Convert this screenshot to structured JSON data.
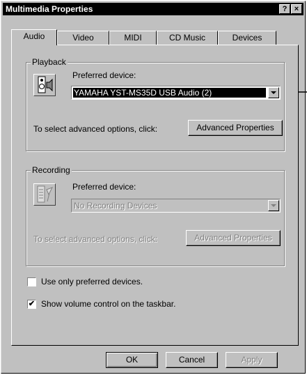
{
  "window": {
    "title": "Multimedia Properties",
    "help_button": "?",
    "close_button": "×"
  },
  "tabs": [
    "Audio",
    "Video",
    "MIDI",
    "CD Music",
    "Devices"
  ],
  "playback": {
    "group_label": "Playback",
    "preferred_label": "Preferred device:",
    "device_value": "YAMAHA YST-MS35D USB Audio (2)",
    "advanced_text": "To select advanced options, click:",
    "advanced_button": "Advanced Properties"
  },
  "recording": {
    "group_label": "Recording",
    "preferred_label": "Preferred device:",
    "device_value": "No Recording Devices",
    "advanced_text": "To select advanced options, click:",
    "advanced_button": "Advanced Properties"
  },
  "options": {
    "use_preferred_label": "Use only preferred devices.",
    "use_preferred_checked": false,
    "show_volume_label": "Show volume control on the taskbar.",
    "show_volume_checked": true,
    "check_mark": "✔"
  },
  "buttons": {
    "ok": "OK",
    "cancel": "Cancel",
    "apply": "Apply"
  }
}
